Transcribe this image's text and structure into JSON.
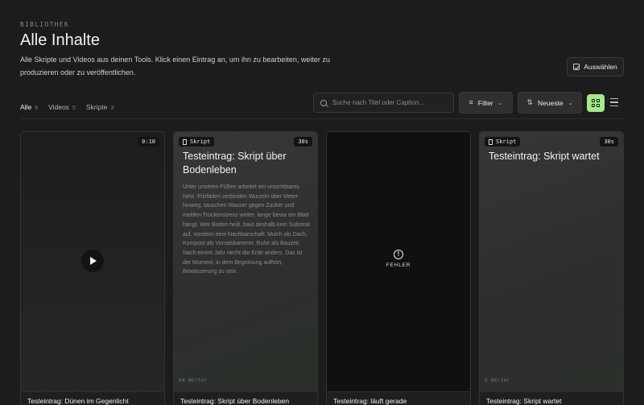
{
  "header": {
    "eyebrow": "BIBLIOTHEK",
    "title": "Alle Inhalte",
    "description": "Alle Skripte und Videos aus deinen Tools. Klick einen Eintrag an, um ihn zu bearbeiten, weiter zu produzieren oder zu veröffentlichen.",
    "select_label": "Auswählen"
  },
  "tabs": [
    {
      "label": "Alle",
      "count": "8"
    },
    {
      "label": "Videos",
      "count": "5"
    },
    {
      "label": "Skripte",
      "count": "3"
    }
  ],
  "toolbar": {
    "search_placeholder": "Suche nach Titel oder Caption...",
    "filter_label": "Filter",
    "sort_label": "Neueste",
    "accent_color": "#a6e88e"
  },
  "cards": [
    {
      "type": "video",
      "duration": "0:10",
      "caption": "Testeintrag: Dünen im Gegenlicht"
    },
    {
      "type": "script",
      "tag": "Skript",
      "duration": "30s",
      "title": "Testeintrag: Skript über Bodenleben",
      "body": "Unter unseren Füßen arbeitet ein unsichtbares Netz. Pilzfäden verbinden Wurzeln über Meter hinweg, tauschen Wasser gegen Zucker und melden Trockenstress weiter, lange bevor ein Blatt hängt. Wer Boden heilt, baut deshalb kein Substrat auf, sondern eine Nachbarschaft: Mulch als Dach, Kompost als Vorratskammer, Ruhe als Bauzeit. Nach einem Jahr riecht die Erde anders. Das ist der Moment, in dem Begrünung aufhört, Bewässerung zu sein.",
      "words": "64 Wörter",
      "caption": "Testeintrag: Skript über Bodenleben"
    },
    {
      "type": "error",
      "status": "FEHLER",
      "caption": "Testeintrag: läuft gerade"
    },
    {
      "type": "script",
      "tag": "Skript",
      "duration": "30s",
      "title": "Testeintrag: Skript wartet",
      "words": "5 Wörter",
      "caption": "Testeintrag: Skript wartet"
    }
  ]
}
